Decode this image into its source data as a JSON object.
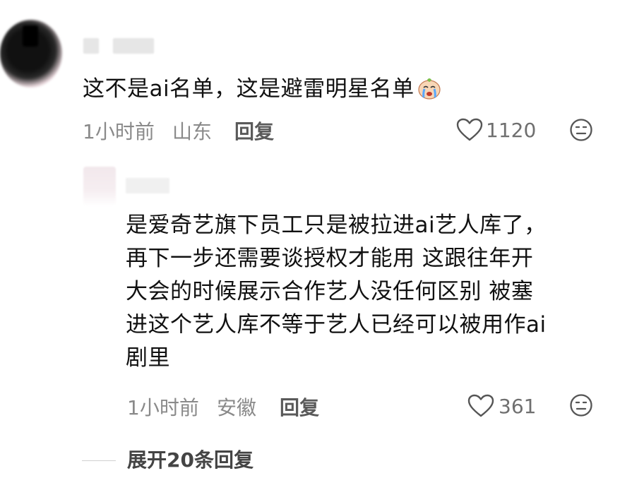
{
  "comment": {
    "text": "这不是ai名单，这是避雷明星名单",
    "emoji": "crying-emoji",
    "time": "1小时前",
    "location": "山东",
    "reply_label": "回复",
    "likes": "1120"
  },
  "reply": {
    "lines": [
      "是爱奇艺旗下员工只是被拉进ai艺人库了，",
      "再下一步还需要谈授权才能用 这跟往年开",
      "大会的时候展示合作艺人没任何区别 被塞",
      "进这个艺人库不等于艺人已经可以被用作ai",
      "剧里"
    ],
    "time": "1小时前",
    "location": "安徽",
    "reply_label": "回复",
    "likes": "361"
  },
  "expand_label": "展开20条回复",
  "colors": {
    "text": "#111111",
    "meta": "#8a8a8a",
    "icon": "#555555"
  }
}
